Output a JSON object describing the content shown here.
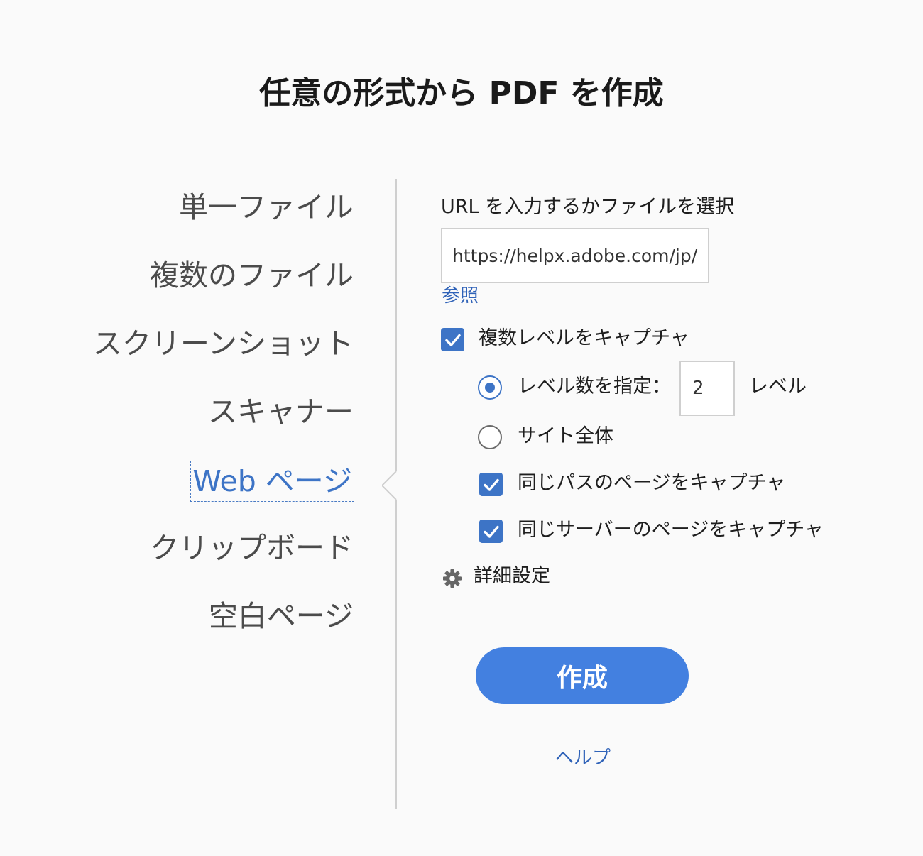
{
  "title": "任意の形式から PDF を作成",
  "nav": {
    "items": [
      {
        "label": "単一ファイル"
      },
      {
        "label": "複数のファイル"
      },
      {
        "label": "スクリーンショット"
      },
      {
        "label": "スキャナー"
      },
      {
        "label": "Web ページ",
        "active": true
      },
      {
        "label": "クリップボード"
      },
      {
        "label": "空白ページ"
      }
    ]
  },
  "web": {
    "url_label": "URL を入力するかファイルを選択",
    "url_value": "https://helpx.adobe.com/jp/",
    "browse_label": "参照",
    "multi_level": {
      "label": "複数レベルをキャプチャ",
      "checked": true
    },
    "levels_option": {
      "label": "レベル数を指定：",
      "selected": true
    },
    "levels_value": "2",
    "levels_unit": "レベル",
    "whole_site_option": {
      "label": "サイト全体",
      "selected": false
    },
    "same_path": {
      "label": "同じパスのページをキャプチャ",
      "checked": true
    },
    "same_server": {
      "label": "同じサーバーのページをキャプチャ",
      "checked": true
    },
    "advanced_label": "詳細設定",
    "create_label": "作成",
    "help_label": "ヘルプ"
  },
  "colors": {
    "accent": "#3d74c6",
    "button": "#4380e0",
    "link": "#2f62b8"
  },
  "icons": {
    "checkbox": "checkmark-icon",
    "advanced": "gear-icon"
  }
}
